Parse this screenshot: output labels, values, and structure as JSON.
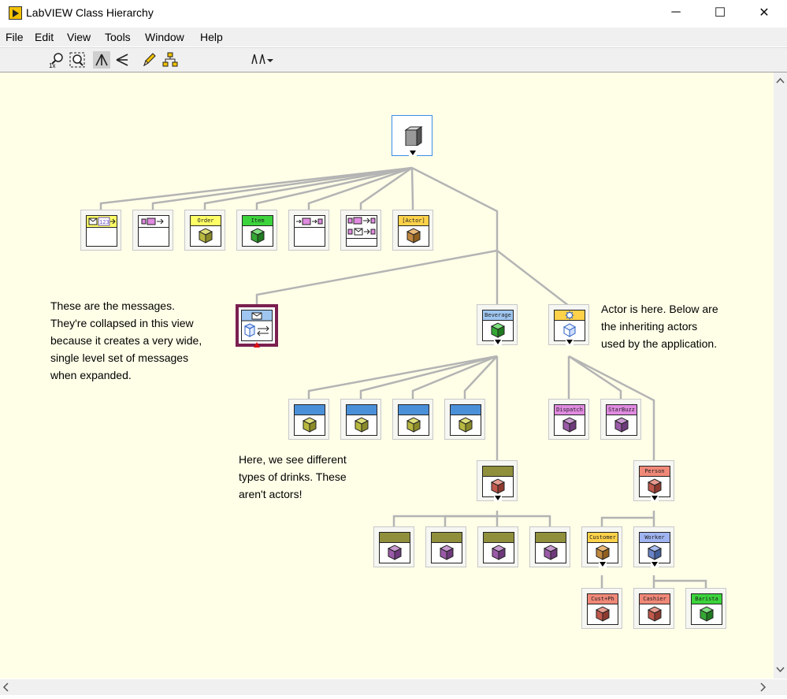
{
  "window": {
    "title": "LabVIEW Class Hierarchy",
    "controls": [
      "─",
      "☐",
      "✕"
    ]
  },
  "menu": [
    "File",
    "Edit",
    "View",
    "Tools",
    "Window",
    "Help"
  ],
  "toolbar": {
    "icons": [
      "zoom-1x-icon",
      "zoom-fit-icon",
      "vertical-layout-icon",
      "horizontal-layout-icon",
      "edit-icon",
      "hierarchy-icon",
      "include-dropdown-icon"
    ],
    "zoom_label": "1x"
  },
  "nodes": {
    "root": "",
    "msg_order": "Order",
    "msg_item": "Item",
    "msg_actor": "[Actor]",
    "beverage": "Beverage",
    "dispatch": "Dispatch",
    "starbuzz": "StarBuzz",
    "person": "Person",
    "customer": "Customer",
    "worker": "Worker",
    "custph": "Cust+Ph",
    "cashier": "Cashier",
    "barista": "Barista"
  },
  "notes": {
    "messages": "These are the messages.\nThey're collapsed in this view\nbecause it creates a very wide,\nsingle level set of messages\nwhen expanded.",
    "actor": "Actor is here. Below are\nthe inheriting actors\nused by the application.",
    "drinks": "Here, we see different\ntypes of drinks. These\naren't actors!"
  },
  "colors": {
    "canvas": "#ffffe8",
    "wire": "#b4b4b4",
    "yellow_band": "#ffff66",
    "green_band": "#3cd43c",
    "pink_band": "#e08ae0",
    "blue_band": "#4a90d9",
    "olive_band": "#8f8f3c",
    "salmon_band": "#f08878",
    "message_frame": "#7a1f4f"
  }
}
